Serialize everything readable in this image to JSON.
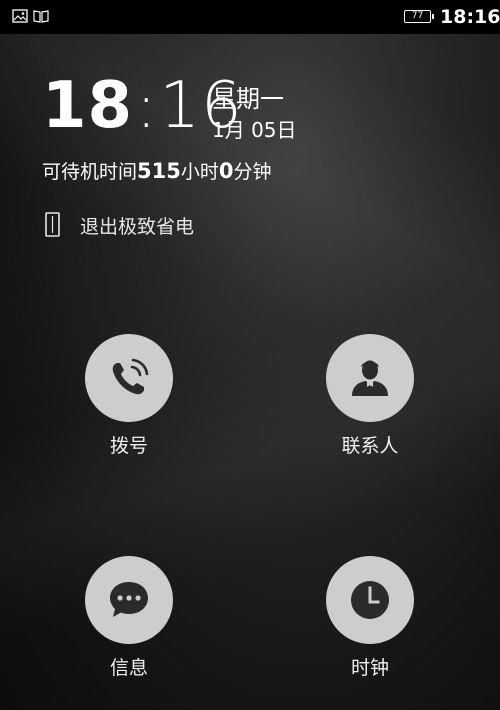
{
  "status_bar": {
    "icons": [
      "gallery-icon",
      "reader-icon"
    ],
    "battery": "77",
    "time": "18:16"
  },
  "clock": {
    "hours": "18",
    "separator": ":",
    "minutes": "16",
    "weekday": "星期一",
    "date": "1月 05日"
  },
  "standby": {
    "prefix": "可待机时间",
    "hours_value": "515",
    "hours_unit": "小时",
    "minutes_value": "0",
    "minutes_unit": "分钟"
  },
  "exit_power_saving": {
    "label": "退出极致省电",
    "icon": "phone-outline-icon"
  },
  "apps": [
    {
      "label": "拨号",
      "icon": "phone-call-icon"
    },
    {
      "label": "联系人",
      "icon": "contact-person-icon"
    },
    {
      "label": "信息",
      "icon": "message-bubble-icon"
    },
    {
      "label": "时钟",
      "icon": "clock-icon"
    }
  ],
  "colors": {
    "status_bar_bg": "#000000",
    "tile_circle": "#cdcdcd",
    "icon_dark": "#2b2b2b",
    "text": "#ffffff"
  }
}
